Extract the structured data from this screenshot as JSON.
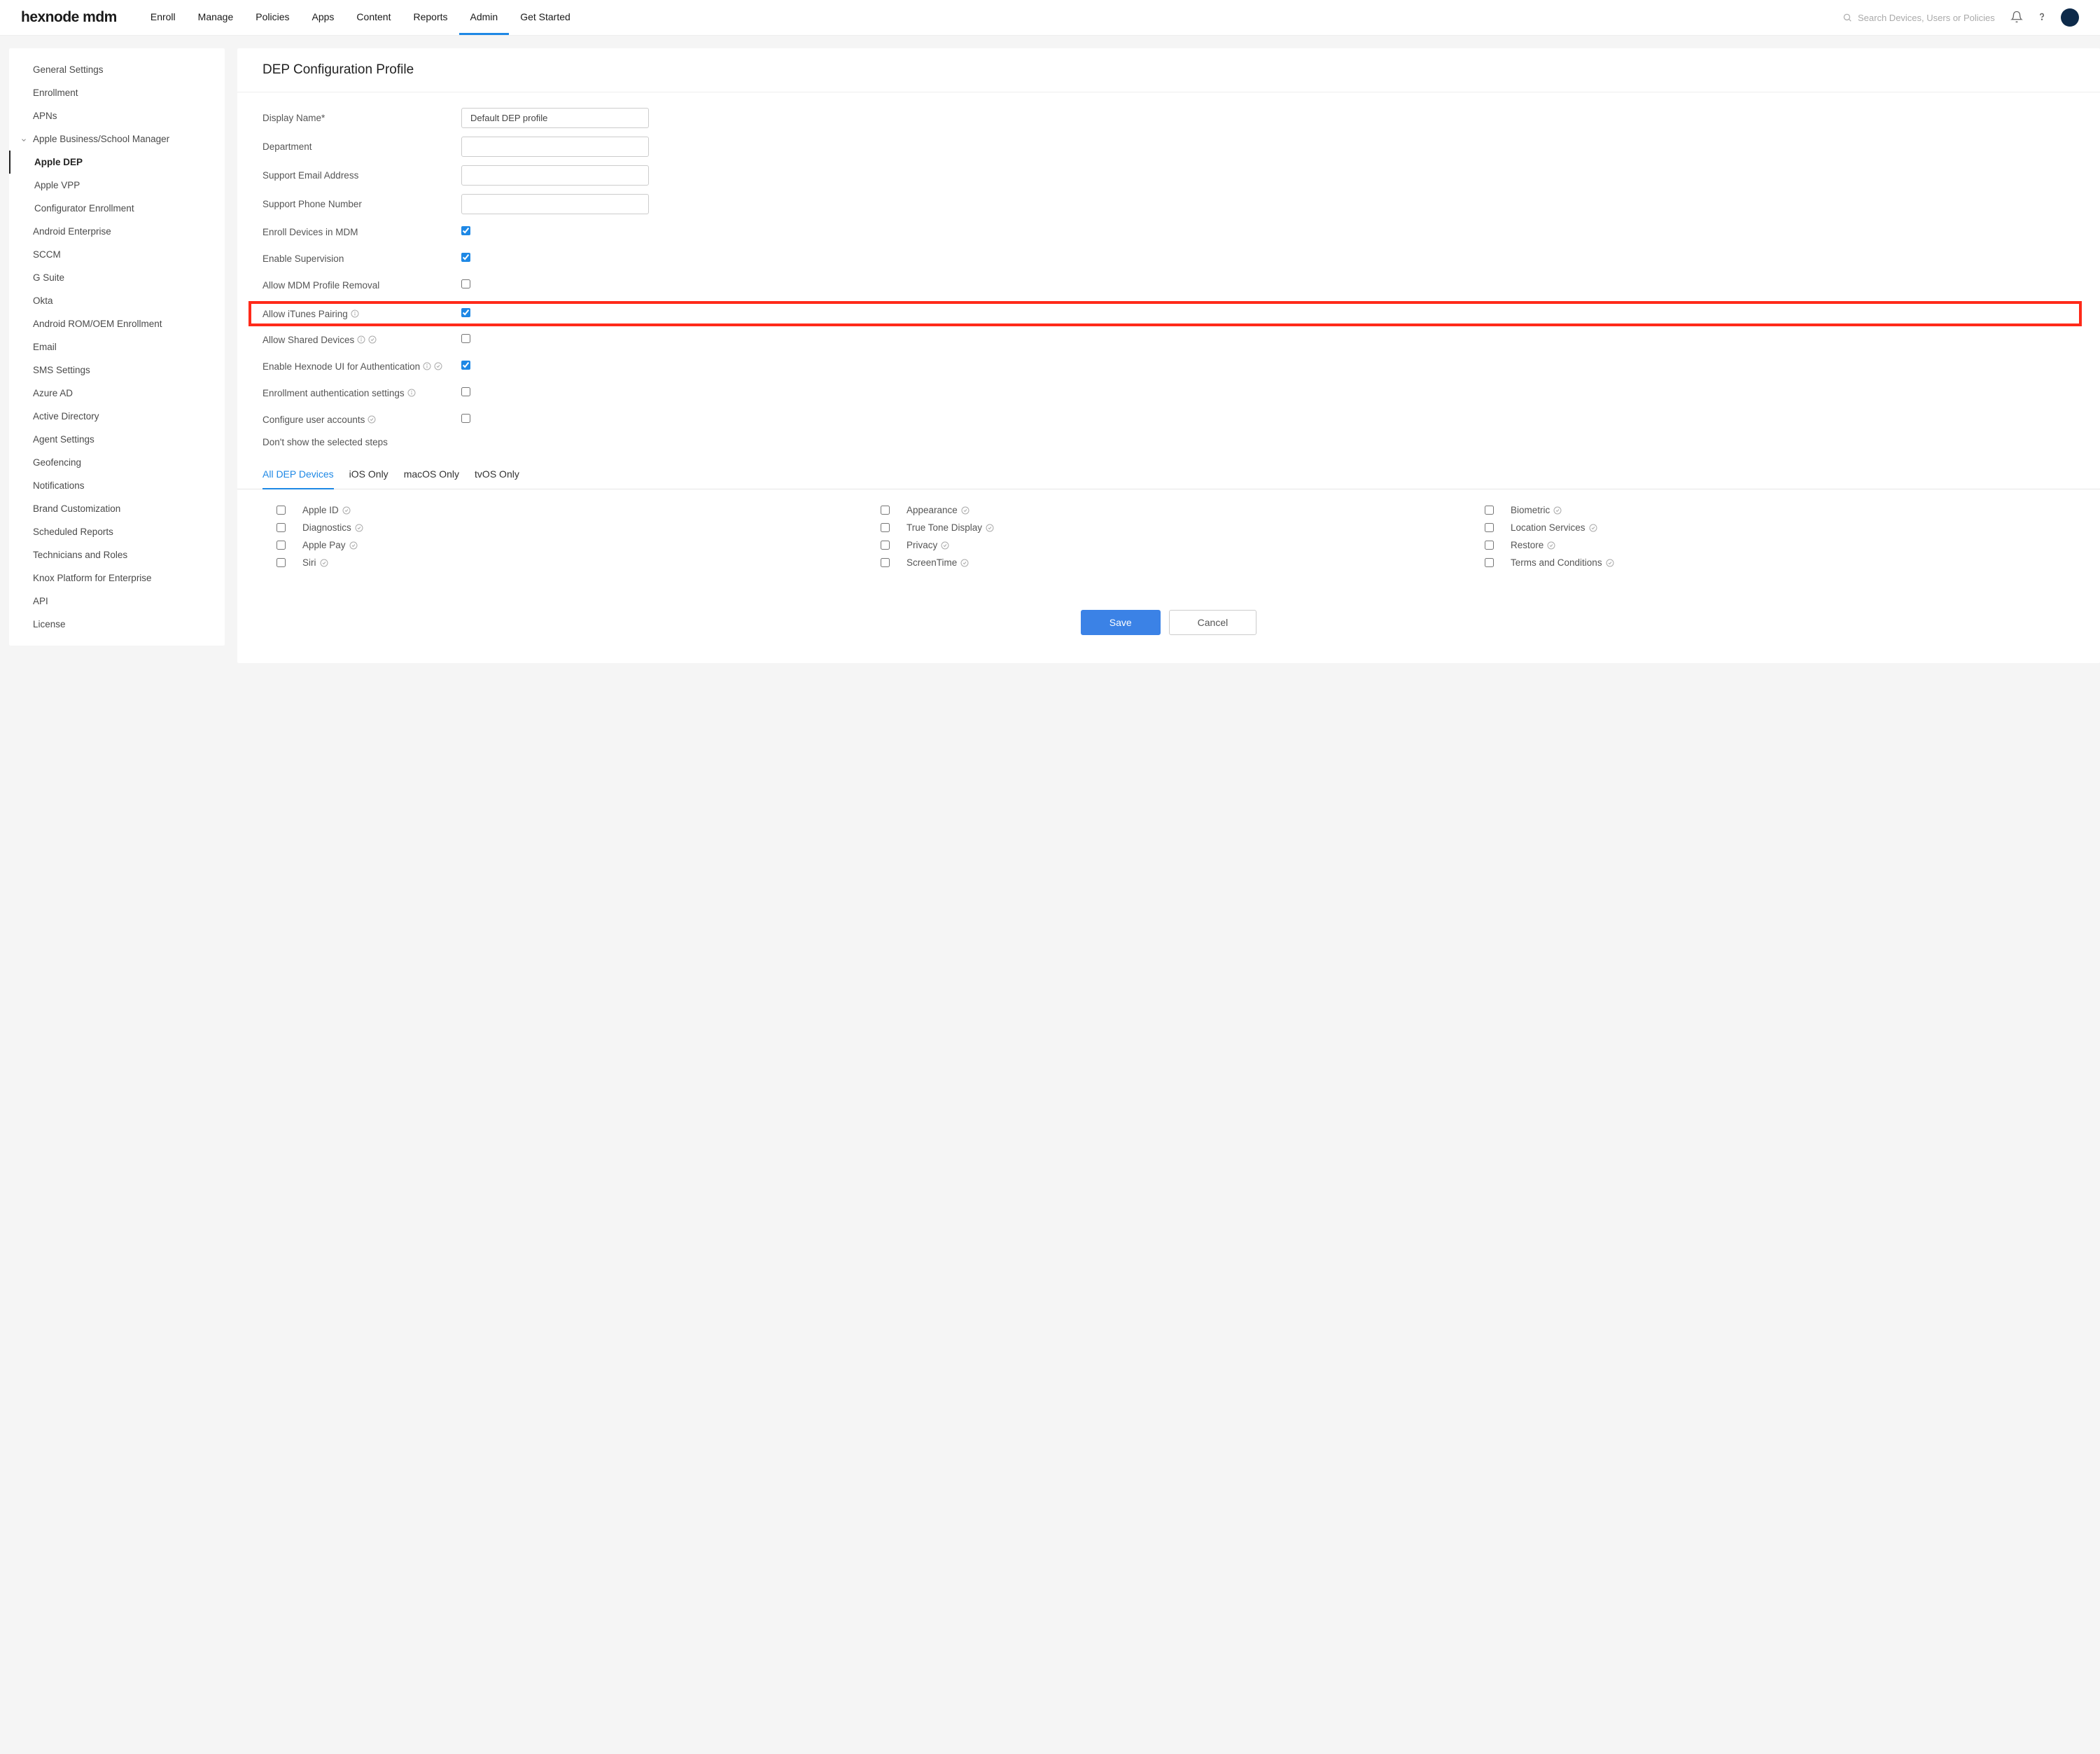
{
  "logo": "hexnode mdm",
  "nav": {
    "items": [
      {
        "label": "Enroll",
        "active": false
      },
      {
        "label": "Manage",
        "active": false
      },
      {
        "label": "Policies",
        "active": false
      },
      {
        "label": "Apps",
        "active": false
      },
      {
        "label": "Content",
        "active": false
      },
      {
        "label": "Reports",
        "active": false
      },
      {
        "label": "Admin",
        "active": true
      },
      {
        "label": "Get Started",
        "active": false
      }
    ]
  },
  "search": {
    "placeholder": "Search Devices, Users or Policies"
  },
  "sidebar": {
    "items": [
      {
        "label": "General Settings"
      },
      {
        "label": "Enrollment"
      },
      {
        "label": "APNs"
      },
      {
        "label": "Apple Business/School Manager",
        "parent": true,
        "expanded": true
      },
      {
        "label": "Apple DEP",
        "child": true,
        "active": true
      },
      {
        "label": "Apple VPP",
        "child": true
      },
      {
        "label": "Configurator Enrollment",
        "child": true
      },
      {
        "label": "Android Enterprise"
      },
      {
        "label": "SCCM"
      },
      {
        "label": "G Suite"
      },
      {
        "label": "Okta"
      },
      {
        "label": "Android ROM/OEM Enrollment"
      },
      {
        "label": "Email"
      },
      {
        "label": "SMS Settings"
      },
      {
        "label": "Azure AD"
      },
      {
        "label": "Active Directory"
      },
      {
        "label": "Agent Settings"
      },
      {
        "label": "Geofencing"
      },
      {
        "label": "Notifications"
      },
      {
        "label": "Brand Customization"
      },
      {
        "label": "Scheduled Reports"
      },
      {
        "label": "Technicians and Roles"
      },
      {
        "label": "Knox Platform for Enterprise"
      },
      {
        "label": "API"
      },
      {
        "label": "License"
      }
    ]
  },
  "page": {
    "title": "DEP Configuration Profile",
    "form": {
      "display_name_label": "Display Name*",
      "display_name_value": "Default DEP profile",
      "department_label": "Department",
      "support_email_label": "Support Email Address",
      "support_phone_label": "Support Phone Number",
      "enroll_mdm": {
        "label": "Enroll Devices in MDM",
        "checked": true
      },
      "enable_supervision": {
        "label": "Enable Supervision",
        "checked": true
      },
      "allow_mdm_removal": {
        "label": "Allow MDM Profile Removal",
        "checked": false
      },
      "allow_itunes": {
        "label": "Allow iTunes Pairing",
        "checked": true,
        "info": true
      },
      "allow_shared": {
        "label": "Allow Shared Devices",
        "checked": false,
        "info": true,
        "check_badge": true
      },
      "enable_hexnode_ui": {
        "label": "Enable Hexnode UI for Authentication",
        "checked": true,
        "info": true,
        "check_badge": true
      },
      "enrollment_auth": {
        "label": "Enrollment authentication settings",
        "checked": false,
        "info": true
      },
      "configure_user": {
        "label": "Configure user accounts",
        "checked": false,
        "check_badge": true
      },
      "dont_show_steps_label": "Don't show the selected steps"
    },
    "tabs": [
      {
        "label": "All DEP Devices",
        "active": true
      },
      {
        "label": "iOS Only",
        "active": false
      },
      {
        "label": "macOS Only",
        "active": false
      },
      {
        "label": "tvOS Only",
        "active": false
      }
    ],
    "steps": [
      {
        "label": "Apple ID",
        "checked": false
      },
      {
        "label": "Appearance",
        "checked": false
      },
      {
        "label": "Biometric",
        "checked": false
      },
      {
        "label": "Diagnostics",
        "checked": false
      },
      {
        "label": "True Tone Display",
        "checked": false
      },
      {
        "label": "Location Services",
        "checked": false
      },
      {
        "label": "Apple Pay",
        "checked": false
      },
      {
        "label": "Privacy",
        "checked": false
      },
      {
        "label": "Restore",
        "checked": false
      },
      {
        "label": "Siri",
        "checked": false
      },
      {
        "label": "ScreenTime",
        "checked": false
      },
      {
        "label": "Terms and Conditions",
        "checked": false
      }
    ],
    "buttons": {
      "save": "Save",
      "cancel": "Cancel"
    }
  }
}
